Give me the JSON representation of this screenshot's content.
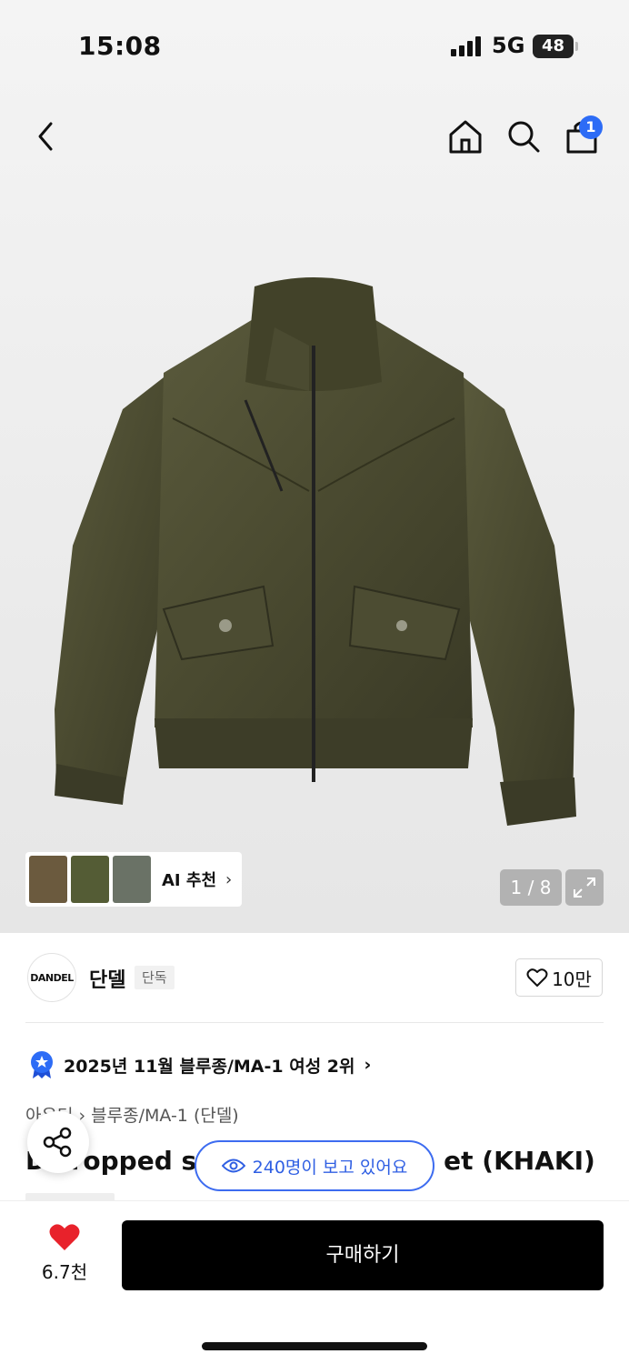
{
  "status_bar": {
    "time": "15:08",
    "network": "5G",
    "battery": "48"
  },
  "header": {
    "cart_count": "1"
  },
  "gallery": {
    "ai_recommend_label": "AI 추천",
    "counter": "1 / 8",
    "thumb_colors": [
      "#6b5a3e",
      "#545c35",
      "#6a7266"
    ]
  },
  "brand": {
    "logo_text": "DANDEL",
    "name": "단델",
    "tag": "단독",
    "likes": "10만"
  },
  "ranking": {
    "text": "2025년 11월 블루종/MA-1 여성 2위"
  },
  "breadcrumb": {
    "root": "아우터",
    "child": "블루종/MA-1 (단델)"
  },
  "product": {
    "title_start": "D cropped s",
    "title_end": "et (KHAKI)",
    "viewers": "240명이 보고 있어요"
  },
  "bottom_bar": {
    "fav_count": "6.7천",
    "buy_label": "구매하기"
  },
  "colors": {
    "accent_blue": "#2d6cf6",
    "heart_red": "#e8222b",
    "buy_bg": "#000000"
  }
}
